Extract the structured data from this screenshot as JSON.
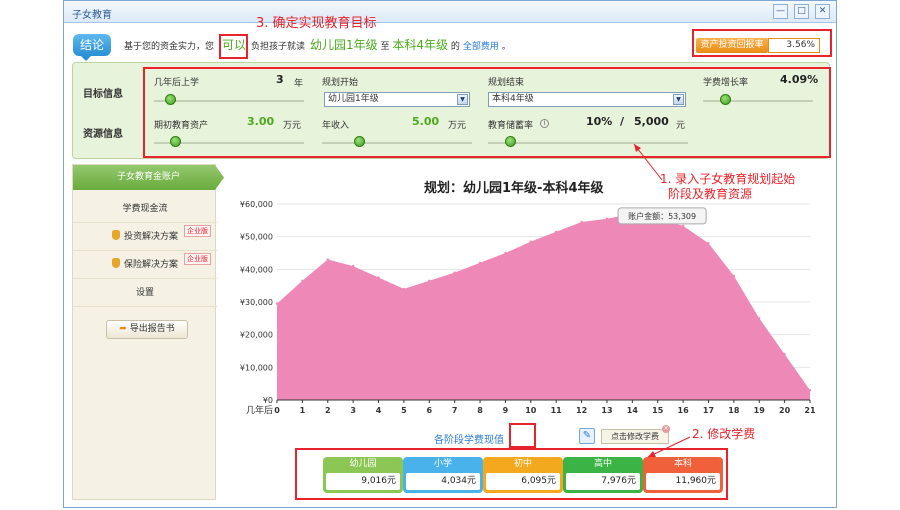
{
  "window": {
    "title": "子女教育",
    "min_label": "—",
    "max_label": "□",
    "close_label": "✕"
  },
  "annotations": {
    "a3": "3. 确定实现教育目标",
    "a1_line1": "1. 录入子女教育规划起始",
    "a1_line2": "阶段及教育资源",
    "a2": "2. 修改学费"
  },
  "conclusion": {
    "badge": "结论",
    "prefix": "基于您的资金实力，您",
    "result": "可以",
    "mid": "负担孩子就读",
    "start_stage": "幼儿园1年级",
    "to": "至",
    "end_stage": "本科4年级",
    "suffix": "的",
    "link": "全部费用",
    "end": "。"
  },
  "roi": {
    "label": "资产投资回报率",
    "value": "3.56%"
  },
  "inputs": {
    "section_goal": "目标信息",
    "section_resource": "资源信息",
    "years_label": "几年后上学",
    "years_value": "3",
    "years_unit": "年",
    "plan_start_label": "规划开始",
    "plan_start_value": "幼儿园1年级",
    "plan_end_label": "规划结束",
    "plan_end_value": "本科4年级",
    "growth_label": "学费增长率",
    "growth_value": "4.09%",
    "initial_label": "期初教育资产",
    "initial_value": "3.00",
    "initial_unit": "万元",
    "income_label": "年收入",
    "income_value": "5.00",
    "income_unit": "万元",
    "saving_label": "教育储蓄率",
    "saving_pct": "10%",
    "saving_sep": "/",
    "saving_amount": "5,000",
    "saving_unit": "元",
    "dropdown_arrow": "▼"
  },
  "sidebar": {
    "active": "子女教育金账户",
    "items": [
      "学费现金流",
      "投资解决方案",
      "保险解决方案",
      "设置"
    ],
    "tag": "企业版",
    "export": "导出报告书",
    "export_icon": "➦"
  },
  "chart_data": {
    "type": "area",
    "title": "规划：幼儿园1年级-本科4年级",
    "xlabel": "几年后",
    "x": [
      0,
      1,
      2,
      3,
      4,
      5,
      6,
      7,
      8,
      9,
      10,
      11,
      12,
      13,
      14,
      15,
      16,
      17,
      18,
      19,
      20,
      21
    ],
    "y": [
      29500,
      36500,
      43000,
      41000,
      37500,
      34000,
      36500,
      39000,
      42000,
      45000,
      48500,
      51500,
      54500,
      55500,
      57000,
      55500,
      53309,
      48000,
      38000,
      25000,
      14000,
      3000
    ],
    "ylim": [
      0,
      60000
    ],
    "yticks": [
      "¥0",
      "¥10,000",
      "¥20,000",
      "¥30,000",
      "¥40,000",
      "¥50,000",
      "¥60,000"
    ],
    "color": "#ee88b7",
    "tooltip": "账户金额：53,309",
    "tooltip_x": 16
  },
  "fees": {
    "label": "各阶段学费现值",
    "pencil_icon": "✎",
    "edit": "点击修改学费",
    "edit_close": "✕",
    "stages": [
      {
        "name": "幼儿园",
        "value": "9,016元",
        "color": "#8cc654"
      },
      {
        "name": "小学",
        "value": "4,034元",
        "color": "#4ab2ea"
      },
      {
        "name": "初中",
        "value": "6,095元",
        "color": "#f3a81d"
      },
      {
        "name": "高中",
        "value": "7,976元",
        "color": "#3cb445"
      },
      {
        "name": "本科",
        "value": "11,960元",
        "color": "#f0603a"
      }
    ]
  }
}
